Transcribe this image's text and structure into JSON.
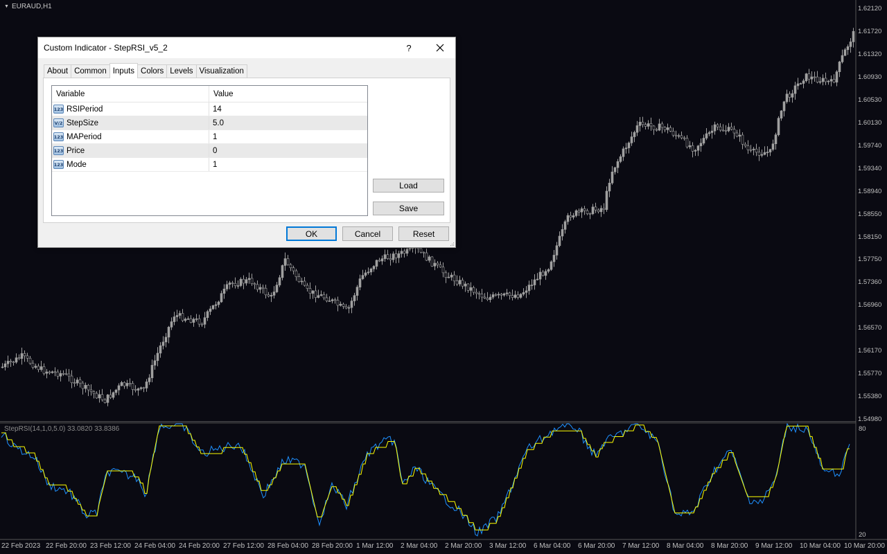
{
  "chart": {
    "symbol": "EURAUD,H1",
    "price_labels": [
      "1.62120",
      "1.61720",
      "1.61320",
      "1.60930",
      "1.60530",
      "1.60130",
      "1.59740",
      "1.59340",
      "1.58940",
      "1.58550",
      "1.58150",
      "1.57750",
      "1.57360",
      "1.56960",
      "1.56570",
      "1.56170",
      "1.55770",
      "1.55380",
      "1.54980"
    ],
    "time_labels": [
      "22 Feb 2023",
      "22 Feb 20:00",
      "23 Feb 12:00",
      "24 Feb 04:00",
      "24 Feb 20:00",
      "27 Feb 12:00",
      "28 Feb 04:00",
      "28 Feb 20:00",
      "1 Mar 12:00",
      "2 Mar 04:00",
      "2 Mar 20:00",
      "3 Mar 12:00",
      "6 Mar 04:00",
      "6 Mar 20:00",
      "7 Mar 12:00",
      "8 Mar 04:00",
      "8 Mar 20:00",
      "9 Mar 12:00",
      "10 Mar 04:00",
      "10 Mar 20:00"
    ],
    "indicator_label": "StepRSI(14,1,0,5.0)",
    "indicator_values": "33.0820 33.8386",
    "osc_top": "80",
    "osc_bottom": "20",
    "colors": {
      "background": "#0a0a12",
      "candle": "#a0a0a0",
      "rsi_line": "#1e90ff",
      "step_line": "#ffff00"
    }
  },
  "dialog": {
    "title": "Custom Indicator - StepRSI_v5_2",
    "help": "?",
    "tabs": [
      "About",
      "Common",
      "Inputs",
      "Colors",
      "Levels",
      "Visualization"
    ],
    "active_tab": "Inputs",
    "grid": {
      "columns": [
        "Variable",
        "Value"
      ],
      "rows": [
        {
          "icon": "123",
          "variable": "RSIPeriod",
          "value": "14"
        },
        {
          "icon": "V/2",
          "variable": "StepSize",
          "value": "5.0"
        },
        {
          "icon": "123",
          "variable": "MAPeriod",
          "value": "1"
        },
        {
          "icon": "123",
          "variable": "Price",
          "value": "0"
        },
        {
          "icon": "123",
          "variable": "Mode",
          "value": "1"
        }
      ]
    },
    "buttons": {
      "load": "Load",
      "save": "Save",
      "ok": "OK",
      "cancel": "Cancel",
      "reset": "Reset"
    }
  }
}
